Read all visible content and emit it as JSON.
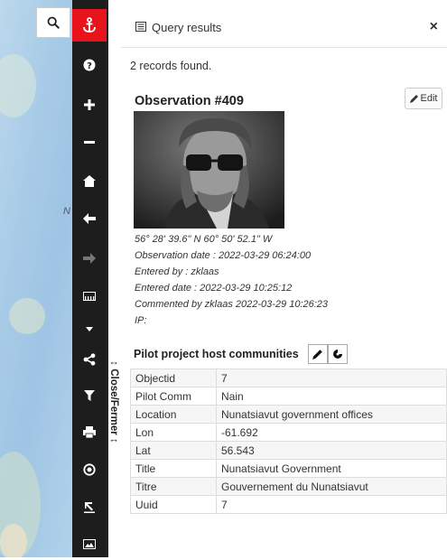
{
  "panel": {
    "title": "Query results",
    "record_count_text": "2 records found.",
    "close_label": "×"
  },
  "observation": {
    "title": "Observation #409",
    "edit_label": "Edit",
    "coordinates": "56° 28' 39.6\" N 60° 50' 52.1\" W",
    "observation_date": "Observation date : 2022-03-29 06:24:00",
    "entered_by": "Entered by : zklaas",
    "entered_date": "Entered date : 2022-03-29 10:25:12",
    "commented_by": "Commented by zklaas 2022-03-29 10:26:23",
    "ip": "IP:"
  },
  "layer": {
    "title": "Pilot project host communities",
    "rows": [
      {
        "key": "Objectid",
        "value": "7"
      },
      {
        "key": "Pilot Comm",
        "value": "Nain"
      },
      {
        "key": "Location",
        "value": "Nunatsiavut government offices"
      },
      {
        "key": "Lon",
        "value": "-61.692"
      },
      {
        "key": "Lat",
        "value": "56.543"
      },
      {
        "key": "Title",
        "value": "Nunatsiavut Government"
      },
      {
        "key": "Titre",
        "value": "Gouvernement du Nunatsiavut"
      },
      {
        "key": "Uuid",
        "value": "7"
      }
    ]
  },
  "sidebar": {
    "close_label": "↕ Close/Fermer ↕"
  },
  "map": {
    "label_fragment": "N"
  },
  "toolbar": {
    "items": [
      "anchor-icon",
      "help-icon",
      "zoom-in-icon",
      "zoom-out-icon",
      "home-icon",
      "back-icon",
      "forward-icon",
      "measure-icon",
      "dropdown-icon",
      "share-icon",
      "filter-icon",
      "print-icon",
      "locate-icon",
      "upload-icon",
      "image-icon"
    ],
    "active_color": "#e8131b"
  }
}
